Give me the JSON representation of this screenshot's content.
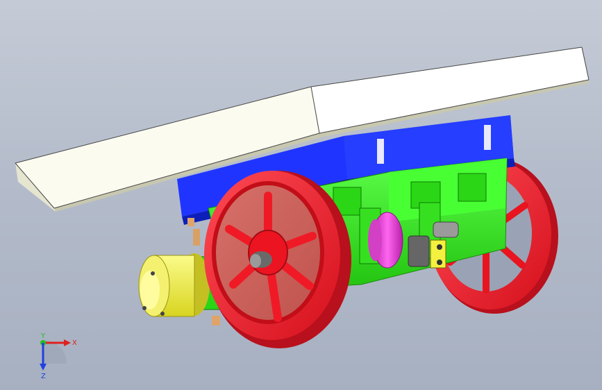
{
  "viewport": {
    "background": "#b4bccb"
  },
  "model": {
    "parts": [
      {
        "name": "top-plate",
        "color": "#f5f5ee"
      },
      {
        "name": "base-frame",
        "color": "#1f35ff"
      },
      {
        "name": "engine-block",
        "color": "#32ff1a"
      },
      {
        "name": "cylinder",
        "color": "#f2f04a"
      },
      {
        "name": "eccentric",
        "color": "#e63bd9"
      },
      {
        "name": "flywheel",
        "color": "#ff2030"
      },
      {
        "name": "crank-parts",
        "color": "#5a5a5a"
      },
      {
        "name": "bolts",
        "color": "#d9a066"
      }
    ]
  },
  "triad": {
    "x_label": "X",
    "y_label": "Y",
    "z_label": "Z",
    "x_color": "#e02020",
    "y_color": "#20c020",
    "z_color": "#2040e0"
  }
}
